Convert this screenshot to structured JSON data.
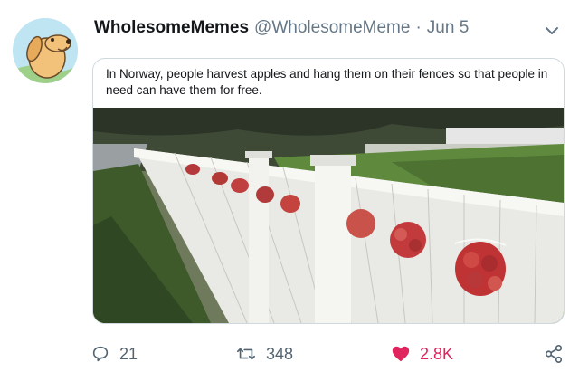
{
  "tweet": {
    "display_name": "WholesomeMemes",
    "handle": "@WholesomeMeme",
    "separator": "·",
    "date": "Jun 5",
    "text": "In Norway, people harvest apples and hang them on their fences so that people in need can have them for free.",
    "replies": "21",
    "retweets": "348",
    "likes": "2.8K"
  },
  "colors": {
    "like_red": "#e0245e",
    "muted": "#657786",
    "avatar_bg": "#bfe4f2"
  },
  "icons": [
    "avatar-dog",
    "chevron-down-icon",
    "reply-icon",
    "retweet-icon",
    "heart-icon",
    "share-icon"
  ]
}
